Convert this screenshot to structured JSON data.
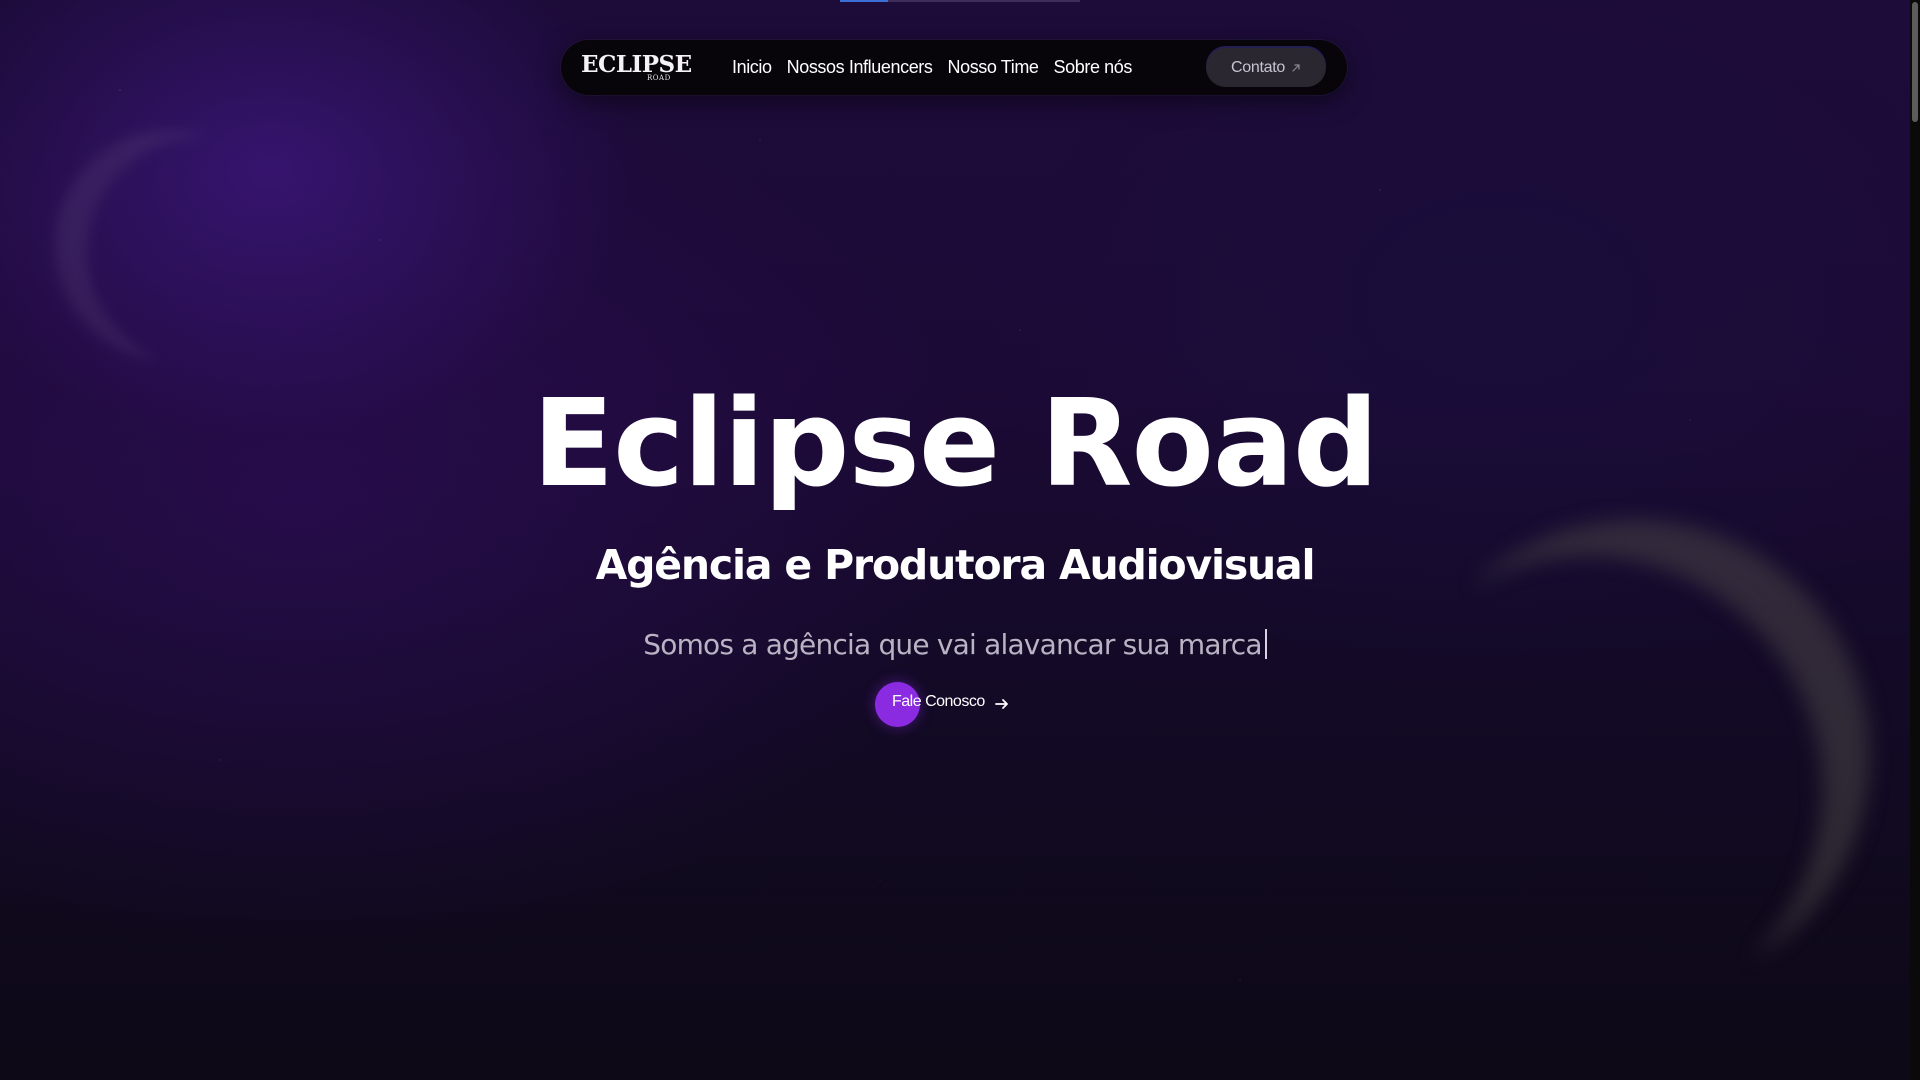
{
  "nav": {
    "logo_text": "ECLIPSE",
    "logo_subtext": "ROAD",
    "links": [
      {
        "label": "Inicio"
      },
      {
        "label": "Nossos Influencers"
      },
      {
        "label": "Nosso Time"
      },
      {
        "label": "Sobre nós"
      }
    ],
    "contact_label": "Contato",
    "contact_icon": "arrow-up-right-icon"
  },
  "hero": {
    "title": "Eclipse Road",
    "subtitle": "Agência e Produtora Audiovisual",
    "tagline": "Somos a agência que vai alavancar sua marca",
    "cta_label": "Fale Conosco",
    "cta_icon": "arrow-right-icon"
  },
  "colors": {
    "accent": "#8a2be2",
    "nav_background": "#07050a",
    "contact_button": "#2a2730",
    "progress_indicator": "#3b6fd6"
  }
}
